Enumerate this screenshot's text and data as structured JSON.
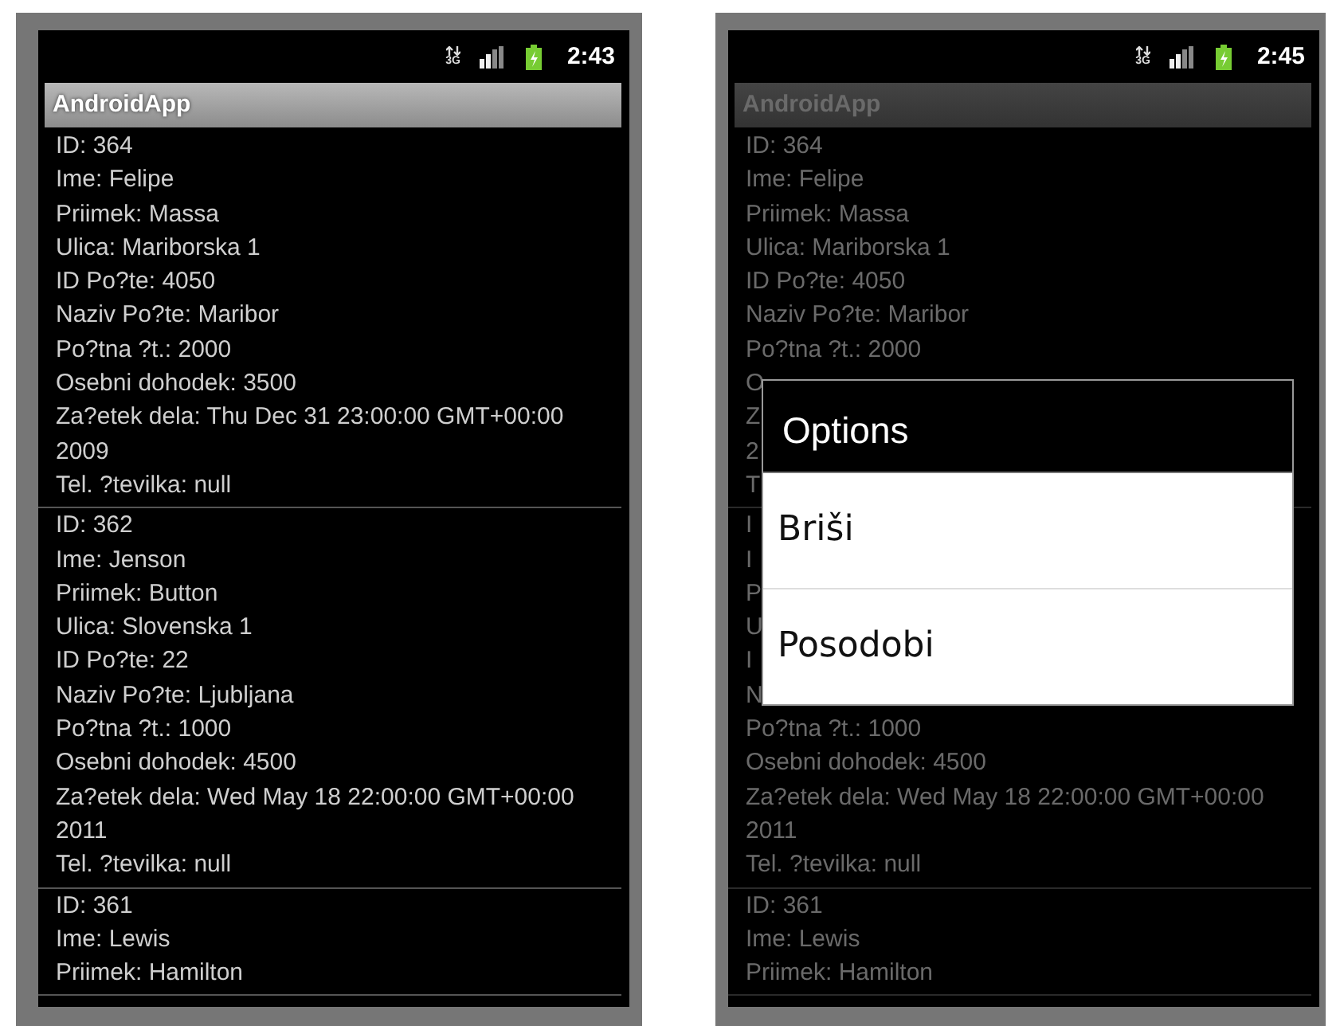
{
  "phones": [
    {
      "status_bar": {
        "network": "3G",
        "time": "2:43"
      },
      "title": "AndroidApp",
      "dimmed": false,
      "records": [
        {
          "lines": [
            "ID: 364",
            "Ime: Felipe",
            "Priimek: Massa",
            "Ulica: Mariborska 1",
            "ID Po?te: 4050",
            "Naziv Po?te: Maribor",
            "Po?tna ?t.: 2000",
            "Osebni dohodek: 3500",
            "Za?etek dela: Thu Dec 31 23:00:00 GMT+00:00 2009",
            "Tel. ?tevilka: null"
          ]
        },
        {
          "lines": [
            "ID: 362",
            "Ime: Jenson",
            "Priimek: Button",
            "Ulica: Slovenska 1",
            "ID Po?te: 22",
            "Naziv Po?te: Ljubljana",
            "Po?tna ?t.: 1000",
            "Osebni dohodek: 4500",
            "Za?etek dela: Wed May 18 22:00:00 GMT+00:00 2011",
            "Tel. ?tevilka: null"
          ]
        },
        {
          "lines": [
            "ID: 361",
            "Ime: Lewis",
            "Priimek: Hamilton"
          ]
        }
      ]
    },
    {
      "status_bar": {
        "network": "3G",
        "time": "2:45"
      },
      "title": "AndroidApp",
      "dimmed": true,
      "records": [
        {
          "lines": [
            "ID: 364",
            "Ime: Felipe",
            "Priimek: Massa",
            "Ulica: Mariborska 1",
            "ID Po?te: 4050",
            "Naziv Po?te: Maribor",
            "Po?tna ?t.: 2000",
            "O",
            "Z",
            "2",
            "T"
          ]
        },
        {
          "lines": [
            "I",
            "I",
            "P",
            "U",
            "I",
            "N",
            "Po?tna ?t.: 1000",
            "Osebni dohodek: 4500",
            "Za?etek dela: Wed May 18 22:00:00 GMT+00:00 2011",
            "Tel. ?tevilka: null"
          ]
        },
        {
          "lines": [
            "ID: 361",
            "Ime: Lewis",
            "Priimek: Hamilton"
          ]
        }
      ],
      "dialog": {
        "title": "Options",
        "items": [
          {
            "label": "Briši"
          },
          {
            "label": "Posodobi"
          }
        ]
      }
    }
  ]
}
